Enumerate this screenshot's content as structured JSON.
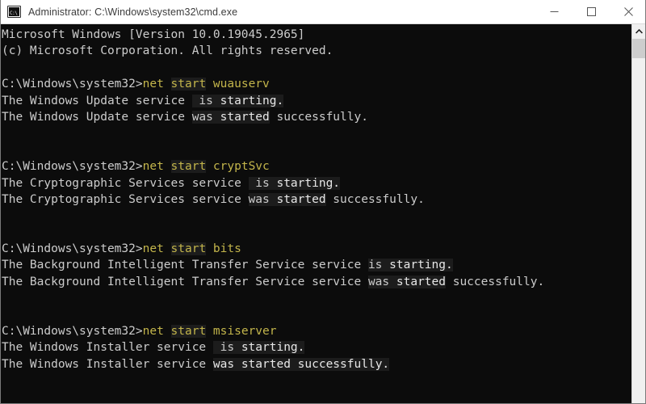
{
  "window": {
    "title": "Administrator: C:\\Windows\\system32\\cmd.exe",
    "app_icon": "cmd-console-icon",
    "icon_prompt_glyph": "C:\\",
    "background_color": "#0c0c0c",
    "titlebar_color": "#ffffff",
    "border_color": "#7a7a7a"
  },
  "titlebar_buttons": {
    "minimize": "minimize",
    "maximize": "maximize",
    "close": "close"
  },
  "scrollbar": {
    "up_arrow": "scroll-up-arrow",
    "thumb": "scroll-thumb",
    "track_color": "#f0f0f0",
    "thumb_color": "#cdcdcd"
  },
  "colors": {
    "text": "#cccccc",
    "command_yellow": "#c3b54b",
    "highlight": "#1c1c1c",
    "bright_text": "#e8e8e8"
  },
  "console": {
    "prompt": "C:\\Windows\\system32>",
    "lines": [
      {
        "id": "banner-version",
        "segments": [
          {
            "text": "Microsoft Windows [Version 10.0.19045.2965]",
            "style": "white"
          }
        ]
      },
      {
        "id": "banner-copyright",
        "segments": [
          {
            "text": "(c) Microsoft Corporation. All rights reserved.",
            "style": "white"
          }
        ]
      },
      {
        "id": "blank-1",
        "segments": [
          {
            "text": " ",
            "style": "blank"
          }
        ]
      },
      {
        "id": "prompt-wuauserv",
        "segments": [
          {
            "text": "C:\\Windows\\system32>",
            "style": "white"
          },
          {
            "text": "net ",
            "style": "yellow"
          },
          {
            "text": "start",
            "style": "yellow-hl"
          },
          {
            "text": " wuauserv",
            "style": "yellow"
          }
        ]
      },
      {
        "id": "wuauserv-starting",
        "segments": [
          {
            "text": "The Windows Update service ",
            "style": "white"
          },
          {
            "text": " is ",
            "style": "white-hl"
          },
          {
            "text": "starting.",
            "style": "bright-hl"
          }
        ]
      },
      {
        "id": "wuauserv-started",
        "segments": [
          {
            "text": "The Windows Update service ",
            "style": "white"
          },
          {
            "text": "was ",
            "style": "white-hl"
          },
          {
            "text": "started",
            "style": "bright-hl"
          },
          {
            "text": " successfully.",
            "style": "white"
          }
        ]
      },
      {
        "id": "blank-2",
        "segments": [
          {
            "text": " ",
            "style": "blank"
          }
        ]
      },
      {
        "id": "blank-3",
        "segments": [
          {
            "text": " ",
            "style": "blank"
          }
        ]
      },
      {
        "id": "prompt-cryptsvc",
        "segments": [
          {
            "text": "C:\\Windows\\system32>",
            "style": "white"
          },
          {
            "text": "net ",
            "style": "yellow"
          },
          {
            "text": "start",
            "style": "yellow-hl"
          },
          {
            "text": " cryptSvc",
            "style": "yellow"
          }
        ]
      },
      {
        "id": "cryptsvc-starting",
        "segments": [
          {
            "text": "The Cryptographic Services service ",
            "style": "white"
          },
          {
            "text": " is ",
            "style": "white-hl"
          },
          {
            "text": "starting.",
            "style": "bright-hl"
          }
        ]
      },
      {
        "id": "cryptsvc-started",
        "segments": [
          {
            "text": "The Cryptographic Services service ",
            "style": "white"
          },
          {
            "text": "was ",
            "style": "white-hl"
          },
          {
            "text": "started",
            "style": "bright-hl"
          },
          {
            "text": " successfully.",
            "style": "white"
          }
        ]
      },
      {
        "id": "blank-4",
        "segments": [
          {
            "text": " ",
            "style": "blank"
          }
        ]
      },
      {
        "id": "blank-5",
        "segments": [
          {
            "text": " ",
            "style": "blank"
          }
        ]
      },
      {
        "id": "prompt-bits",
        "segments": [
          {
            "text": "C:\\Windows\\system32>",
            "style": "white"
          },
          {
            "text": "net ",
            "style": "yellow"
          },
          {
            "text": "start",
            "style": "yellow-hl"
          },
          {
            "text": " bits",
            "style": "yellow"
          }
        ]
      },
      {
        "id": "bits-starting",
        "segments": [
          {
            "text": "The Background Intelligent Transfer Service service ",
            "style": "white"
          },
          {
            "text": "is ",
            "style": "white-hl"
          },
          {
            "text": "starting.",
            "style": "bright-hl"
          }
        ]
      },
      {
        "id": "bits-started",
        "segments": [
          {
            "text": "The Background Intelligent Transfer Service service ",
            "style": "white"
          },
          {
            "text": "was ",
            "style": "white-hl"
          },
          {
            "text": "started",
            "style": "bright-hl"
          },
          {
            "text": " successfully.",
            "style": "white"
          }
        ]
      },
      {
        "id": "blank-6",
        "segments": [
          {
            "text": " ",
            "style": "blank"
          }
        ]
      },
      {
        "id": "blank-7",
        "segments": [
          {
            "text": " ",
            "style": "blank"
          }
        ]
      },
      {
        "id": "prompt-msiserver",
        "segments": [
          {
            "text": "C:\\Windows\\system32>",
            "style": "white"
          },
          {
            "text": "net ",
            "style": "yellow"
          },
          {
            "text": "start",
            "style": "yellow-hl"
          },
          {
            "text": " msiserver",
            "style": "yellow"
          }
        ]
      },
      {
        "id": "msiserver-starting",
        "segments": [
          {
            "text": "The Windows Installer service ",
            "style": "white"
          },
          {
            "text": " is ",
            "style": "white-hl"
          },
          {
            "text": "starting.",
            "style": "bright-hl"
          }
        ]
      },
      {
        "id": "msiserver-started",
        "segments": [
          {
            "text": "The Windows Installer service ",
            "style": "white"
          },
          {
            "text": "was started successfully.",
            "style": "bright-hl"
          }
        ]
      }
    ]
  }
}
